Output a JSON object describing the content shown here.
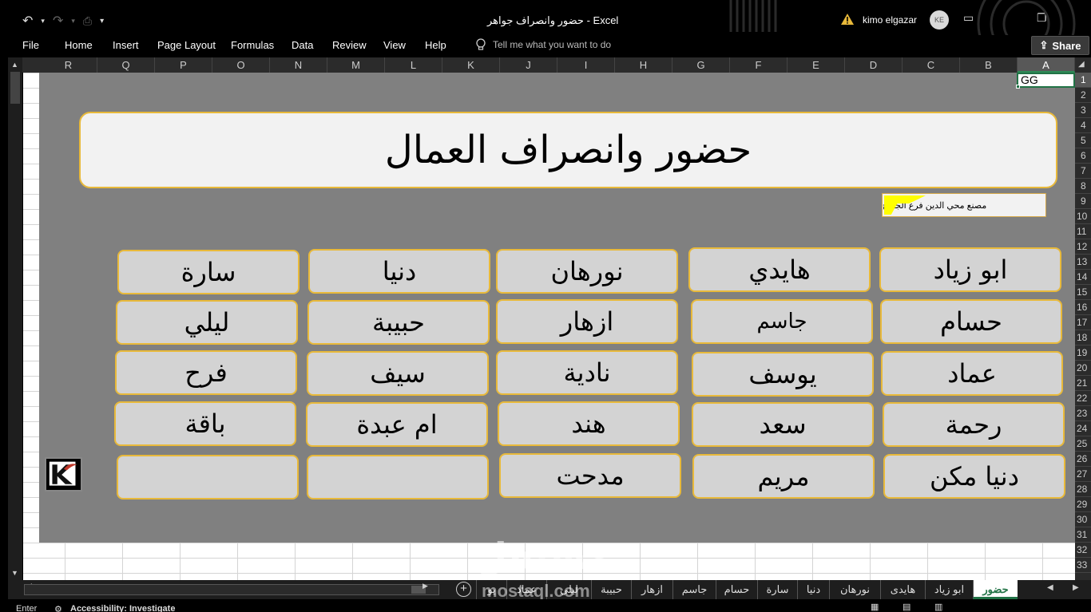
{
  "window": {
    "title": "حضور وانصراف جواهر  -  Excel",
    "user": "kimo elgazar",
    "avatar_initials": "KE"
  },
  "ribbon": {
    "tabs": [
      "File",
      "Home",
      "Insert",
      "Page Layout",
      "Formulas",
      "Data",
      "Review",
      "View",
      "Help"
    ],
    "tell_me": "Tell me what you want to do",
    "share": "Share"
  },
  "columns": [
    "R",
    "Q",
    "P",
    "O",
    "N",
    "M",
    "L",
    "K",
    "J",
    "I",
    "H",
    "G",
    "F",
    "E",
    "D",
    "C",
    "B",
    "A"
  ],
  "rows": [
    "1",
    "2",
    "3",
    "4",
    "5",
    "6",
    "7",
    "8",
    "9",
    "10",
    "11",
    "12",
    "13",
    "14",
    "15",
    "16",
    "17",
    "18",
    "19",
    "20",
    "21",
    "22",
    "23",
    "24",
    "25",
    "26",
    "27",
    "28",
    "29",
    "30",
    "31",
    "32",
    "33"
  ],
  "cell_a1": "GG",
  "dashboard": {
    "title": "حضور وانصراف العمال",
    "subtitle": "مصنع محي الدين فرع الجراج"
  },
  "employees": [
    [
      "ابو زياد",
      "هايدي",
      "نورهان",
      "دنيا",
      "سارة"
    ],
    [
      "حسام",
      "جاسم",
      "ازهار",
      "حبيبة",
      "ليلي"
    ],
    [
      "عماد",
      "يوسف",
      "نادية",
      "سيف",
      "فرح"
    ],
    [
      "رحمة",
      "سعد",
      "هند",
      "ام عبدة",
      "باقة"
    ],
    [
      "دنيا مكن",
      "مريم",
      "مدحت",
      "",
      ""
    ]
  ],
  "sheet_tabs": [
    "حضور",
    "ابو زياد",
    "هايدى",
    "نورهان",
    "دنيا",
    "سارة",
    "حسام",
    "جاسم",
    "ازهار",
    "حبيبة",
    "ليلي",
    "عماد",
    "يو"
  ],
  "status": {
    "mode": "Enter",
    "accessibility": "Accessibility: Investigate"
  },
  "watermark": {
    "arabic": "مستقل",
    "latin": "mostaql.com"
  },
  "colors": {
    "accent_green": "#217346",
    "button_border": "#e8b93a",
    "dashboard_bg": "#808080"
  }
}
